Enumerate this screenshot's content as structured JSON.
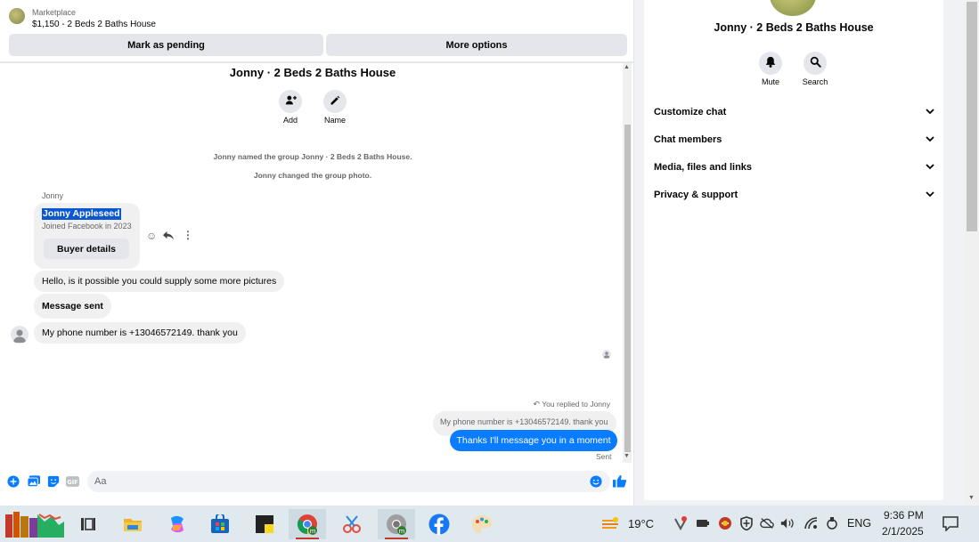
{
  "marketplace": {
    "label": "Marketplace",
    "listing": "$1,150 - 2 Beds 2 Baths House",
    "pending_button": "Mark as pending",
    "more_button": "More options"
  },
  "conversation": {
    "group_title": "Jonny · 2 Beds 2 Baths House",
    "actions": [
      {
        "label": "Add",
        "icon": "add-person-icon"
      },
      {
        "label": "Name",
        "icon": "pencil-icon"
      }
    ],
    "system_messages": [
      "Jonny named the group Jonny · 2 Beds 2 Baths House.",
      "Jonny changed the group photo."
    ],
    "sender_name": "Jonny",
    "profile_card": {
      "name": "Jonny Appleseed",
      "joined": "Joined Facebook in 2023",
      "button": "Buyer details"
    },
    "messages": [
      "Hello, is it possible you could supply some more pictures",
      "Message sent",
      "My phone number is +13046572149. thank you"
    ],
    "reply_note": "You replied to Jonny",
    "quoted_message": "My phone number is +13046572149. thank you",
    "my_message": "Thanks I'll message you in a moment",
    "status": "Sent"
  },
  "composer": {
    "placeholder": "Aa",
    "value": "",
    "accent_color": "#0a7cff"
  },
  "info_panel": {
    "title": "Jonny · 2 Beds 2 Baths House",
    "actions": [
      {
        "label": "Mute",
        "icon": "bell-icon"
      },
      {
        "label": "Search",
        "icon": "search-icon"
      }
    ],
    "sections": [
      "Customize chat",
      "Chat members",
      "Media, files and links",
      "Privacy & support"
    ]
  },
  "taskbar": {
    "weather": "19°C",
    "language": "ENG",
    "time": "9:36 PM",
    "date": "2/1/2025",
    "apps": [
      "file-explorer-icon",
      "task-view-icon",
      "files-icon",
      "copilot-icon",
      "store-icon",
      "sticky-notes-icon",
      "chrome-icon",
      "snipping-tool-icon",
      "chrome-profile-icon",
      "facebook-icon",
      "paint-icon"
    ]
  }
}
